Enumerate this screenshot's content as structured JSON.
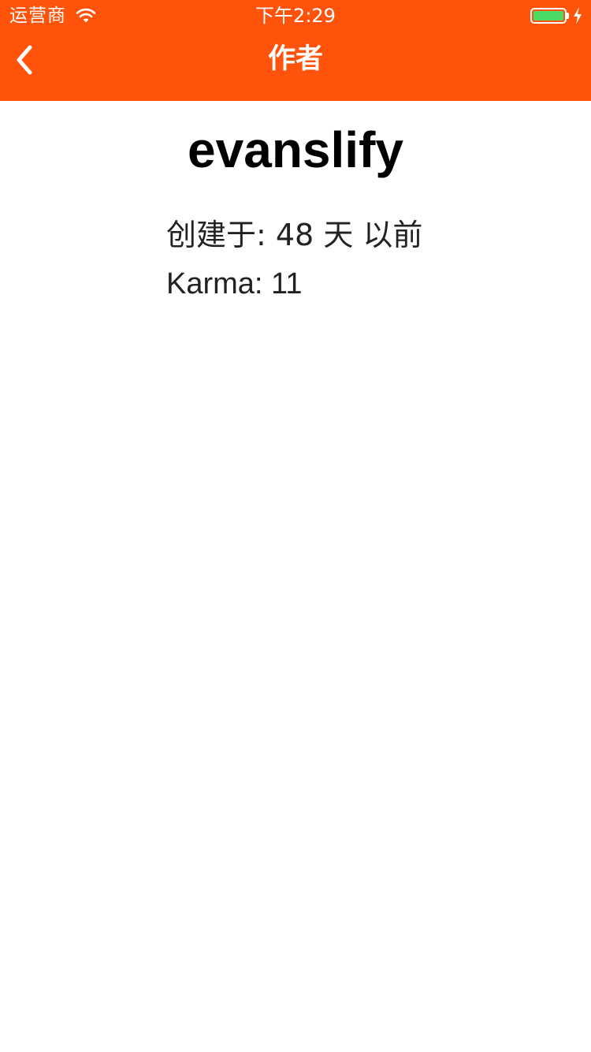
{
  "status_bar": {
    "carrier": "运营商",
    "time": "下午2:29",
    "wifi_icon": "wifi-icon",
    "battery_icon": "battery-icon",
    "charging_icon": "charging-bolt-icon",
    "battery_color": "#4cd964"
  },
  "nav": {
    "title": "作者",
    "back_icon": "chevron-left-icon",
    "background_color": "#ff520a"
  },
  "author": {
    "name": "evanslify",
    "created": "创建于: 48 天 以前",
    "karma": "Karma: 11"
  }
}
